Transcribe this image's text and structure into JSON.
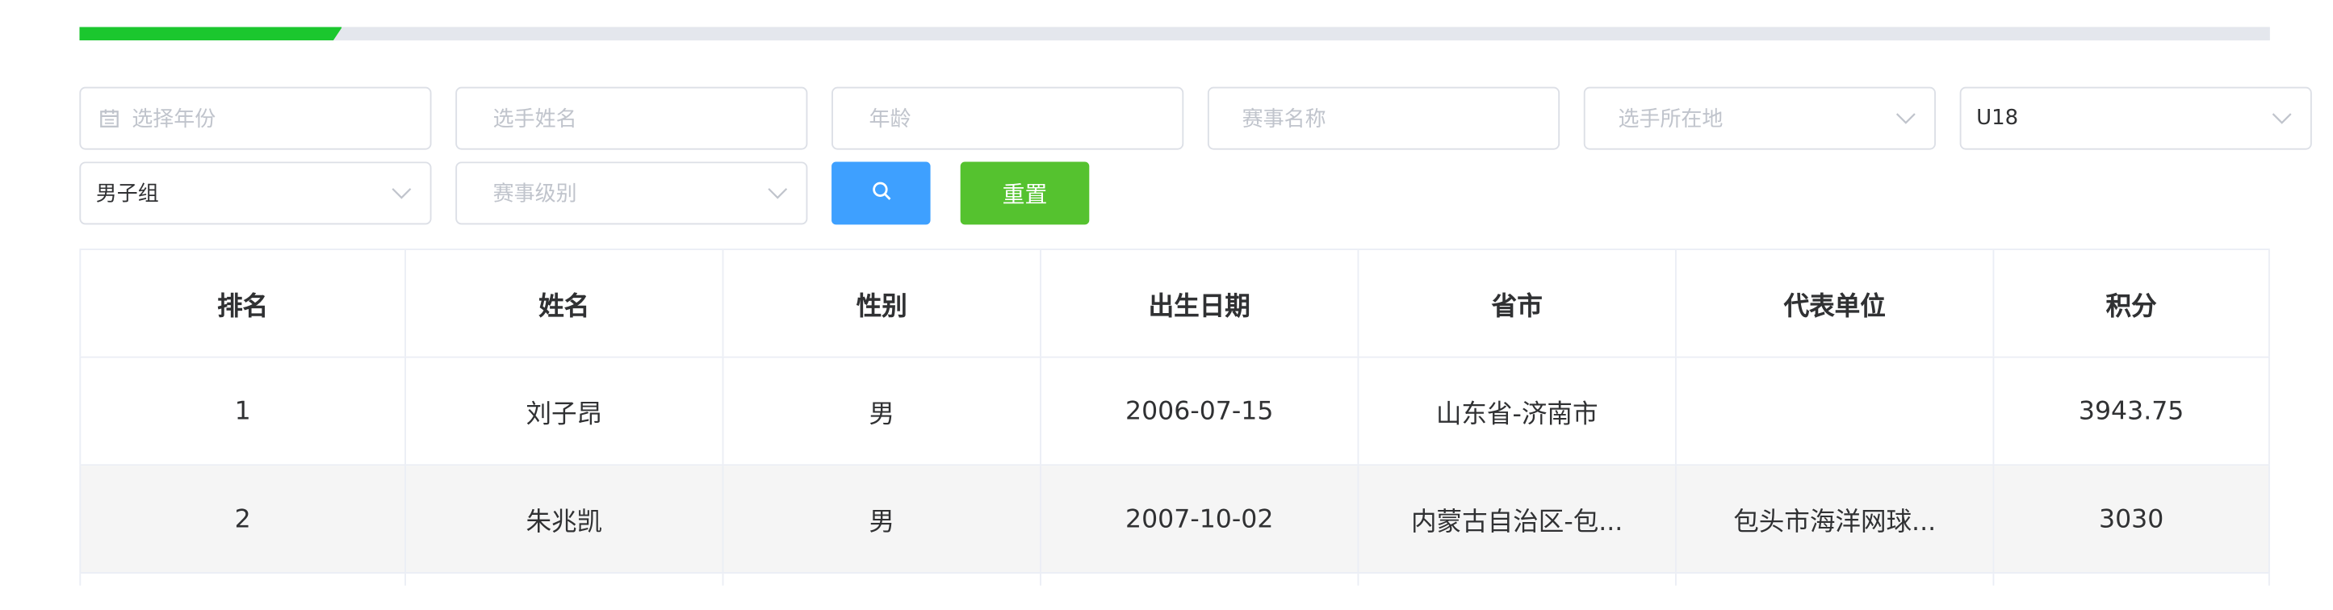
{
  "progress": {
    "value": 0.12,
    "color": "#1bc72e"
  },
  "filters": {
    "year": {
      "placeholder": "选择年份",
      "icon": "calendar-icon"
    },
    "player_name": {
      "placeholder": "选手姓名"
    },
    "age": {
      "placeholder": "年龄"
    },
    "event_name": {
      "placeholder": "赛事名称"
    },
    "location": {
      "placeholder": "选手所在地",
      "icon": "chevron-down-icon"
    },
    "age_group": {
      "value": "U18",
      "icon": "chevron-down-icon"
    },
    "gender_group": {
      "value": "男子组",
      "icon": "chevron-down-icon"
    },
    "event_level": {
      "placeholder": "赛事级别",
      "icon": "chevron-down-icon"
    }
  },
  "buttons": {
    "search": {
      "icon": "search-icon",
      "color": "#3ea0ff"
    },
    "reset": {
      "label": "重置",
      "color": "#55c22f"
    }
  },
  "table": {
    "columns": [
      "排名",
      "姓名",
      "性别",
      "出生日期",
      "省市",
      "代表单位",
      "积分"
    ],
    "rows": [
      [
        "1",
        "刘子昂",
        "男",
        "2006-07-15",
        "山东省-济南市",
        "",
        "3943.75"
      ],
      [
        "2",
        "朱兆凯",
        "男",
        "2007-10-02",
        "内蒙古自治区-包...",
        "包头市海洋网球...",
        "3030"
      ]
    ]
  }
}
